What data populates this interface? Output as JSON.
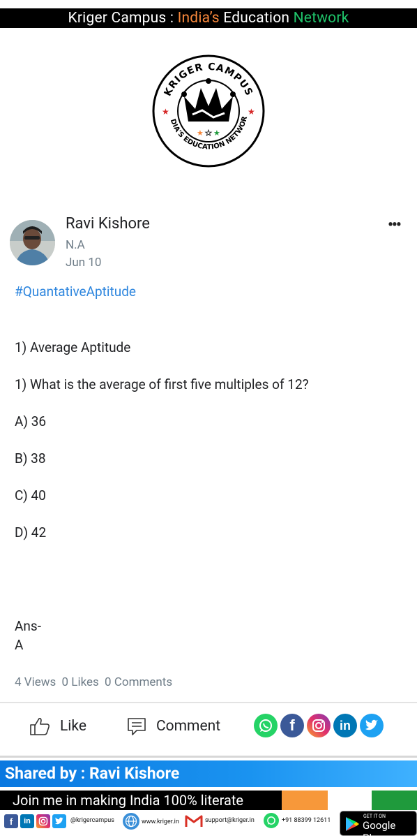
{
  "banner": {
    "part1": "Kriger Campus : ",
    "part2": "India’s",
    "part3": " Education ",
    "part4": "Network"
  },
  "logo": {
    "top_text": "KRIGER CAMPUS",
    "bottom_text": "INDIA'S EDUCATION NETWORK"
  },
  "post": {
    "author": "Ravi Kishore",
    "role": "N.A",
    "date": "Jun 10",
    "hashtag": "#QuantativeAptitude",
    "lines": [
      "1) Average Aptitude",
      "1) What is the average of first five multiples of 12?",
      "A) 36",
      "B) 38",
      "C) 40",
      "D) 42",
      "Ans-",
      "A"
    ]
  },
  "stats": {
    "views": "4 Views",
    "likes": "0 Likes",
    "comments": "0 Comments"
  },
  "actions": {
    "like": "Like",
    "comment": "Comment"
  },
  "share_icons": [
    "whatsapp-icon",
    "facebook-icon",
    "instagram-icon",
    "linkedin-icon",
    "twitter-icon"
  ],
  "shared_by": "Shared by : Ravi Kishore",
  "join_text": "Join me in making India 100% literate",
  "footer": {
    "handle": "@krigercampus",
    "website": "www.kriger.in",
    "email": "support@kriger.in",
    "phone": "+91 88399 12611",
    "play_small": "GET IT ON",
    "play_big": "Google Play"
  },
  "colors": {
    "hashtag": "#2e86de",
    "orange": "#f7873b",
    "green": "#1fc46a",
    "shared_bar": "#0a78e0",
    "whatsapp": "#25d366",
    "facebook": "#3b5998",
    "linkedin": "#0077b5",
    "twitter": "#1da1f2"
  }
}
